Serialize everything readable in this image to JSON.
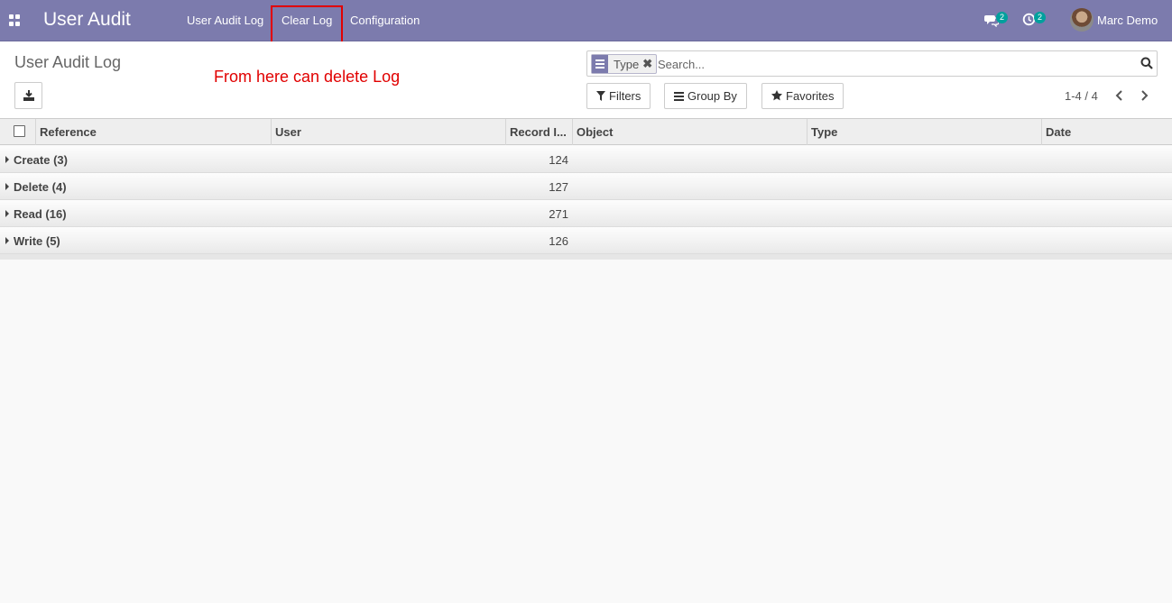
{
  "navbar": {
    "app_title": "User Audit",
    "menu": [
      {
        "label": "User Audit Log"
      },
      {
        "label": "Clear Log"
      },
      {
        "label": "Configuration"
      }
    ],
    "messages_badge": "2",
    "activities_badge": "2",
    "user_name": "Marc Demo"
  },
  "control_panel": {
    "breadcrumb": "User Audit Log",
    "annotation": "From here can delete Log",
    "search": {
      "facet_label": "Type",
      "placeholder": "Search..."
    },
    "filters_label": "Filters",
    "group_by_label": "Group By",
    "favorites_label": "Favorites",
    "pager": "1-4 / 4"
  },
  "list": {
    "columns": [
      "Reference",
      "User",
      "Record I...",
      "Object",
      "Type",
      "Date"
    ],
    "groups": [
      {
        "name": "Create (3)",
        "record_id_sum": "124"
      },
      {
        "name": "Delete (4)",
        "record_id_sum": "127"
      },
      {
        "name": "Read (16)",
        "record_id_sum": "271"
      },
      {
        "name": "Write (5)",
        "record_id_sum": "126"
      }
    ]
  },
  "colors": {
    "navbar": "#7c7bad",
    "annotation": "#e10000",
    "badge": "#00a09d"
  }
}
